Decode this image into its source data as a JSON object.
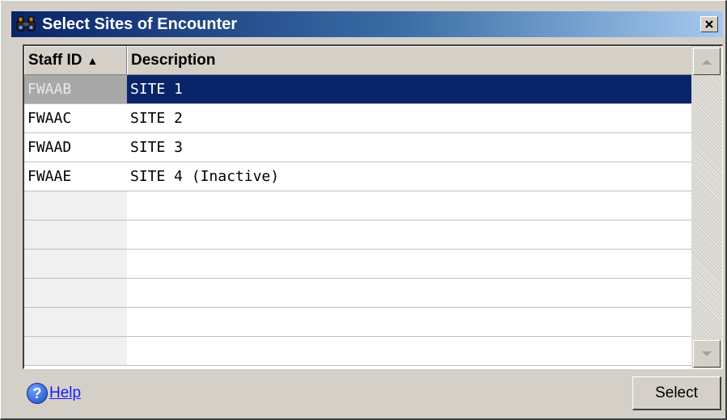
{
  "window": {
    "title": "Select Sites of Encounter",
    "close_glyph": "✕",
    "title_icon": "binoculars-icon"
  },
  "grid": {
    "columns": [
      {
        "label": "Staff ID",
        "sorted": "ascending",
        "sort_glyph": "▲"
      },
      {
        "label": "Description"
      }
    ],
    "rows": [
      {
        "staff_id": "FWAAB",
        "description": "SITE 1",
        "selected": true
      },
      {
        "staff_id": "FWAAC",
        "description": "SITE 2"
      },
      {
        "staff_id": "FWAAD",
        "description": "SITE 3"
      },
      {
        "staff_id": "FWAAE",
        "description": "SITE 4 (Inactive)"
      }
    ],
    "empty_rows": 6,
    "scroll_up_glyph": "▲",
    "scroll_down_glyph": "▼"
  },
  "footer": {
    "help_label": "Help",
    "help_icon_glyph": "?",
    "select_label": "Select"
  },
  "colors": {
    "title_bar": "#0a246a",
    "selection": "#0a246a",
    "link": "#1a1aff",
    "face": "#d4d0c8"
  }
}
